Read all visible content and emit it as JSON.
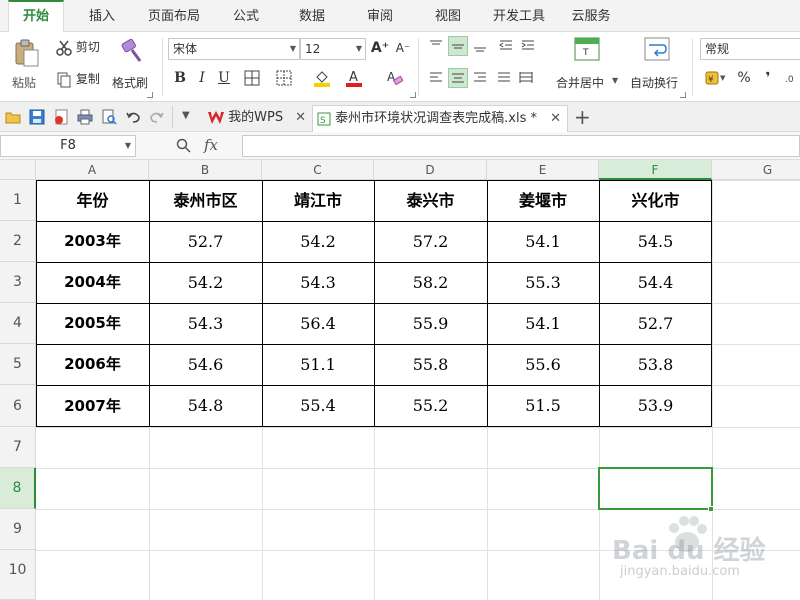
{
  "menu": {
    "tabs": [
      "开始",
      "插入",
      "页面布局",
      "公式",
      "数据",
      "审阅",
      "视图",
      "开发工具",
      "云服务"
    ]
  },
  "ribbon": {
    "paste_label": "粘贴",
    "cut_label": "剪切",
    "copy_label": "复制",
    "format_painter_label": "格式刷",
    "font_name": "宋体",
    "font_size": "12",
    "bold": "B",
    "italic": "I",
    "underline": "U",
    "font_grow": "A⁺",
    "font_shrink": "A⁻",
    "merge_center_label": "合并居中",
    "wrap_text_label": "自动换行",
    "number_format": "常规",
    "percent": "%",
    "comma": "❜"
  },
  "tabstrip": {
    "wps_tab": "我的WPS",
    "doc_tab": "泰州市环境状况调查表完成稿.xls *"
  },
  "formula_bar": {
    "name_box": "F8",
    "fx": "fx",
    "content": ""
  },
  "grid": {
    "columns": [
      "A",
      "B",
      "C",
      "D",
      "E",
      "F",
      "G"
    ],
    "rows": [
      "1",
      "2",
      "3",
      "4",
      "5",
      "6",
      "7",
      "8",
      "9",
      "10"
    ],
    "selected_cell": "F8"
  },
  "table": {
    "headers": [
      "年份",
      "泰州市区",
      "靖江市",
      "泰兴市",
      "姜堰市",
      "兴化市"
    ],
    "rows": [
      [
        "2003年",
        "52.7",
        "54.2",
        "57.2",
        "54.1",
        "54.5"
      ],
      [
        "2004年",
        "54.2",
        "54.3",
        "58.2",
        "55.3",
        "54.4"
      ],
      [
        "2005年",
        "54.3",
        "56.4",
        "55.9",
        "54.1",
        "52.7"
      ],
      [
        "2006年",
        "54.6",
        "51.1",
        "55.8",
        "55.6",
        "53.8"
      ],
      [
        "2007年",
        "54.8",
        "55.4",
        "55.2",
        "51.5",
        "53.9"
      ]
    ]
  },
  "watermark": {
    "brand": "Bai du 经验",
    "url": "jingyan.baidu.com"
  },
  "colors": {
    "accent": "#2e8b3e",
    "selection": "#3a9a3a"
  }
}
